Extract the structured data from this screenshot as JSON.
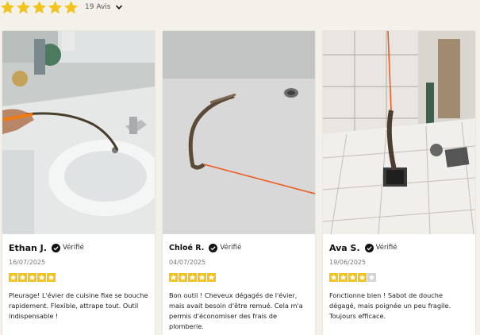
{
  "summary": {
    "rating": 5,
    "count_label": "19 Avis",
    "star_color": "#f2c31b"
  },
  "reviews": [
    {
      "author": "Ethan J.",
      "verified_label": "Vérifié",
      "date": "16/07/2025",
      "stars": 5,
      "text": "Pleurage! L'évier de cuisine fixe se bouche rapidement. Flexible, attrape tout. Outil indispensable !"
    },
    {
      "author": "Chloé R.",
      "verified_label": "Vérifié",
      "date": "04/07/2025",
      "stars": 5,
      "text": "Bon outil ! Cheveux dégagés de l'évier, mais avait besoin d'être remué. Cela m'a permis d'économiser des frais de plomberie."
    },
    {
      "author": "Ava S.",
      "verified_label": "Vérifié",
      "date": "19/06/2025",
      "stars": 4,
      "text": "Fonctionne bien ! Sabot de douche dégagé, mais poignée un peu fragile. Toujours efficace."
    }
  ],
  "icons": {
    "star": "star-icon",
    "verified": "check-circle-icon",
    "expand": "chevron-down-icon"
  }
}
